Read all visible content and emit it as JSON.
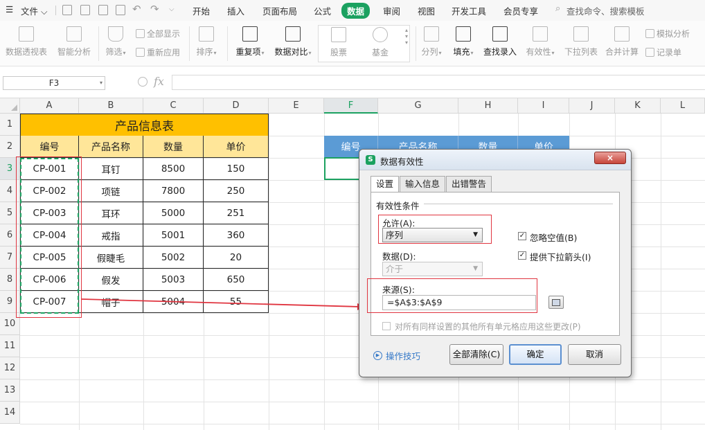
{
  "menubar": {
    "file_label": "文件",
    "tabs": [
      "开始",
      "插入",
      "页面布局",
      "公式",
      "数据",
      "审阅",
      "视图",
      "开发工具",
      "会员专享"
    ],
    "active_tab": "数据",
    "search_placeholder": "查找命令、搜索模板"
  },
  "ribbon": {
    "pivot": "数据透视表",
    "smart_analysis": "智能分析",
    "filter": "筛选",
    "show_all": "全部显示",
    "reapply": "重新应用",
    "sort": "排序",
    "duplicates": "重复项",
    "compare": "数据对比",
    "stocks": "股票",
    "funds": "基金",
    "split": "分列",
    "fill": "填充",
    "lookup_entry": "查找录入",
    "validity": "有效性",
    "dropdown_list": "下拉列表",
    "consolidate": "合并计算",
    "what_if": "模拟分析",
    "record_form": "记录单"
  },
  "formula_bar": {
    "name_box": "F3",
    "fx": "fx",
    "formula": ""
  },
  "sheet": {
    "columns": [
      "A",
      "B",
      "C",
      "D",
      "E",
      "F",
      "G",
      "H",
      "I",
      "J",
      "K",
      "L"
    ],
    "rows": [
      "1",
      "2",
      "3",
      "4",
      "5",
      "6",
      "7",
      "8",
      "9",
      "10",
      "11",
      "12",
      "13",
      "14"
    ],
    "selected_column": "F",
    "selected_row": "3",
    "table_title": "产品信息表",
    "headers": [
      "编号",
      "产品名称",
      "数量",
      "单价"
    ],
    "records": [
      [
        "CP-001",
        "耳钉",
        "8500",
        "150"
      ],
      [
        "CP-002",
        "项链",
        "7800",
        "250"
      ],
      [
        "CP-003",
        "耳环",
        "5000",
        "251"
      ],
      [
        "CP-004",
        "戒指",
        "5001",
        "360"
      ],
      [
        "CP-005",
        "假睫毛",
        "5002",
        "20"
      ],
      [
        "CP-006",
        "假发",
        "5003",
        "650"
      ],
      [
        "CP-007",
        "帽子",
        "5004",
        "55"
      ]
    ],
    "right_headers": [
      "编号",
      "产品名称",
      "数量",
      "单价"
    ]
  },
  "dialog": {
    "title": "数据有效性",
    "close": "×",
    "tabs": [
      "设置",
      "输入信息",
      "出错警告"
    ],
    "active_tab": "设置",
    "group_label": "有效性条件",
    "allow_label": "允许(A):",
    "allow_value": "序列",
    "data_label": "数据(D):",
    "data_value": "介于",
    "ignore_blank": "忽略空值(B)",
    "ignore_blank_checked": true,
    "dropdown_arrow": "提供下拉箭头(I)",
    "dropdown_arrow_checked": true,
    "source_label": "来源(S):",
    "source_value": "=$A$3:$A$9",
    "apply_all": "对所有同样设置的其他所有单元格应用这些更改(P)",
    "tips": "操作技巧",
    "clear_all": "全部清除(C)",
    "ok": "确定",
    "cancel": "取消"
  },
  "colors": {
    "accent": "#1ba160",
    "title_fill": "#ffc000",
    "header_fill": "#ffe699",
    "blue_header": "#5b9bd5",
    "annotation": "#e0343f"
  }
}
